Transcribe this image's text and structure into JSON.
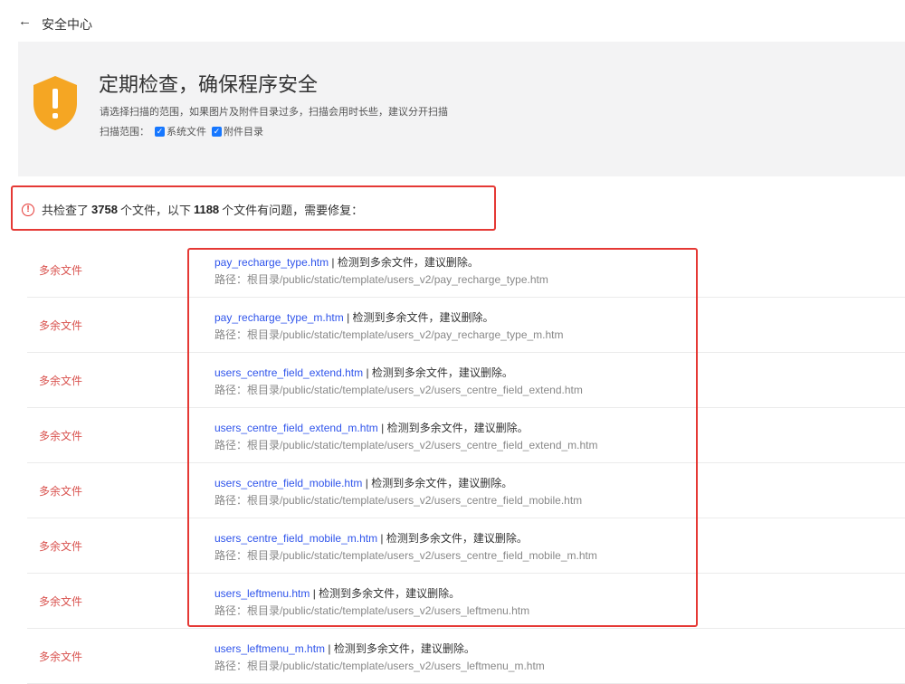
{
  "header": {
    "back_arrow": "←",
    "title": "安全中心"
  },
  "hero": {
    "title": "定期检查，确保程序安全",
    "description": "请选择扫描的范围，如果图片及附件目录过多，扫描会用时长些，建议分开扫描",
    "range_label": "扫描范围：",
    "options": [
      {
        "label": "系统文件",
        "checked": true
      },
      {
        "label": "附件目录",
        "checked": true
      }
    ],
    "icon": "shield-warning-icon",
    "icon_color": "#f5a623"
  },
  "summary": {
    "prefix": "共检查了",
    "checked_count": "3758",
    "middle": "个文件，以下",
    "problem_count": "1188",
    "suffix": "个文件有问题，需要修复："
  },
  "rows": [
    {
      "type": "多余文件",
      "name": "pay_recharge_type.htm",
      "msg": " | 检测到多余文件，建议删除。",
      "path": "路径：根目录/public/static/template/users_v2/pay_recharge_type.htm"
    },
    {
      "type": "多余文件",
      "name": "pay_recharge_type_m.htm",
      "msg": " | 检测到多余文件，建议删除。",
      "path": "路径：根目录/public/static/template/users_v2/pay_recharge_type_m.htm"
    },
    {
      "type": "多余文件",
      "name": "users_centre_field_extend.htm",
      "msg": " | 检测到多余文件，建议删除。",
      "path": "路径：根目录/public/static/template/users_v2/users_centre_field_extend.htm"
    },
    {
      "type": "多余文件",
      "name": "users_centre_field_extend_m.htm",
      "msg": " | 检测到多余文件，建议删除。",
      "path": "路径：根目录/public/static/template/users_v2/users_centre_field_extend_m.htm"
    },
    {
      "type": "多余文件",
      "name": "users_centre_field_mobile.htm",
      "msg": " | 检测到多余文件，建议删除。",
      "path": "路径：根目录/public/static/template/users_v2/users_centre_field_mobile.htm"
    },
    {
      "type": "多余文件",
      "name": "users_centre_field_mobile_m.htm",
      "msg": " | 检测到多余文件，建议删除。",
      "path": "路径：根目录/public/static/template/users_v2/users_centre_field_mobile_m.htm"
    },
    {
      "type": "多余文件",
      "name": "users_leftmenu.htm",
      "msg": " | 检测到多余文件，建议删除。",
      "path": "路径：根目录/public/static/template/users_v2/users_leftmenu.htm"
    },
    {
      "type": "多余文件",
      "name": "users_leftmenu_m.htm",
      "msg": " | 检测到多余文件，建议删除。",
      "path": "路径：根目录/public/static/template/users_v2/users_leftmenu_m.htm"
    }
  ],
  "colors": {
    "accent": "#e53935",
    "link": "#2f54eb",
    "type_text": "#d9534f"
  }
}
